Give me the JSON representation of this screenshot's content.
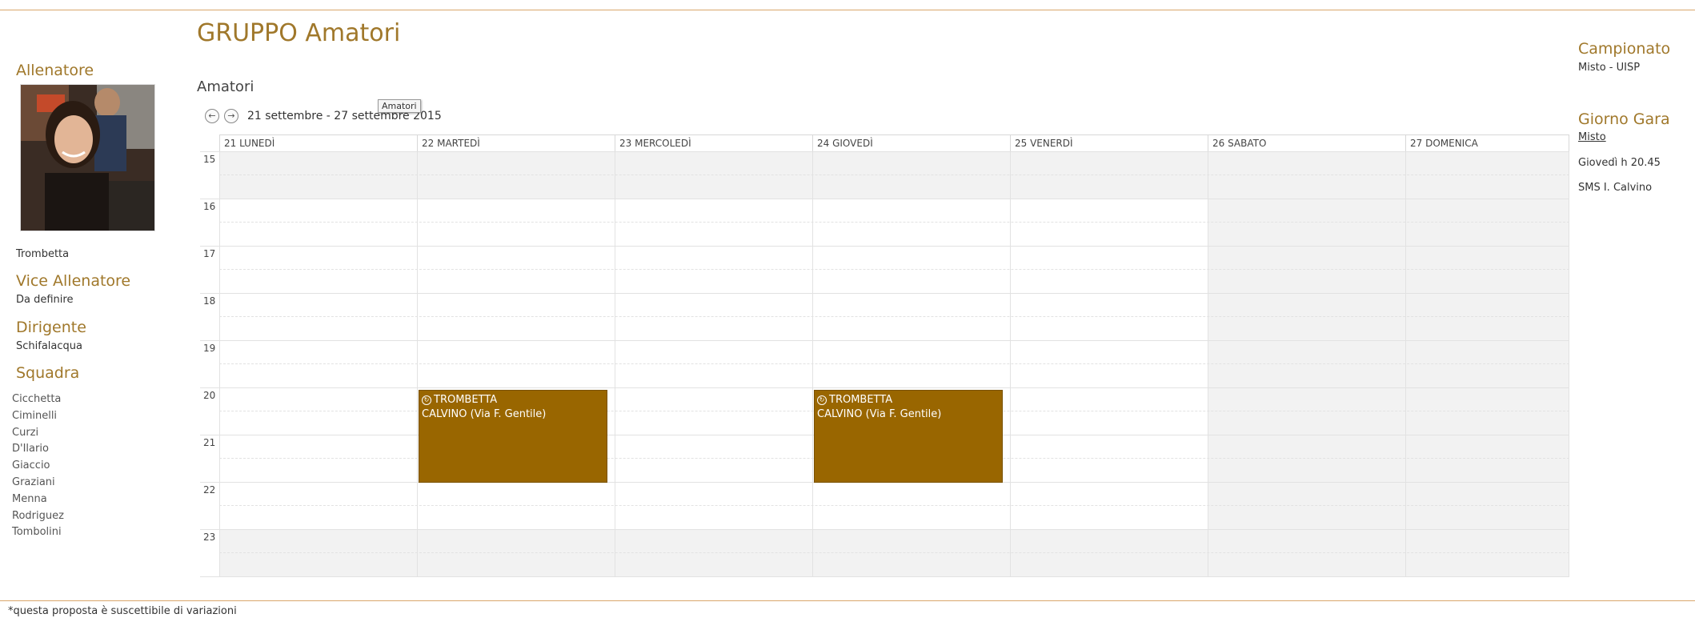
{
  "page": {
    "title": "GRUPPO Amatori",
    "footer_note": "*questa proposta è suscettibile di variazioni"
  },
  "left": {
    "coach_title": "Allenatore",
    "coach_name": "Trombetta",
    "vice_title": "Vice Allenatore",
    "vice_value": "Da definire",
    "manager_title": "Dirigente",
    "manager_value": "Schifalacqua",
    "squad_title": "Squadra",
    "squad": [
      "Cicchetta",
      "Ciminelli",
      "Curzi",
      "D'Ilario",
      "Giaccio",
      "Graziani",
      "Menna",
      "Rodriguez",
      "Tombolini"
    ]
  },
  "right": {
    "championship_title": "Campionato",
    "championship_value": "Misto - UISP",
    "match_day_title": "Giorno Gara",
    "match_day_link": "Misto",
    "match_time": "Giovedì h 20.45",
    "match_venue": "SMS I. Calvino"
  },
  "calendar": {
    "name": "Amatori",
    "tooltip": "Amatori",
    "date_range": "21 settembre - 27 settembre 2015",
    "prev_icon": "arrow-left-icon",
    "next_icon": "arrow-right-icon",
    "days": [
      "21 LUNEDÌ",
      "22 MARTEDÌ",
      "23 MERCOLEDÌ",
      "24 GIOVEDÌ",
      "25 VENERDÌ",
      "26 SABATO",
      "27 DOMENICA"
    ],
    "hours": [
      "15",
      "16",
      "17",
      "18",
      "19",
      "20",
      "21",
      "22",
      "23"
    ],
    "events": [
      {
        "title": "TROMBETTA",
        "location": "CALVINO (Via F. Gentile)",
        "icon": "recurring-icon"
      },
      {
        "title": "TROMBETTA",
        "location": "CALVINO (Via F. Gentile)",
        "icon": "recurring-icon"
      }
    ],
    "event_color": "#996600"
  }
}
